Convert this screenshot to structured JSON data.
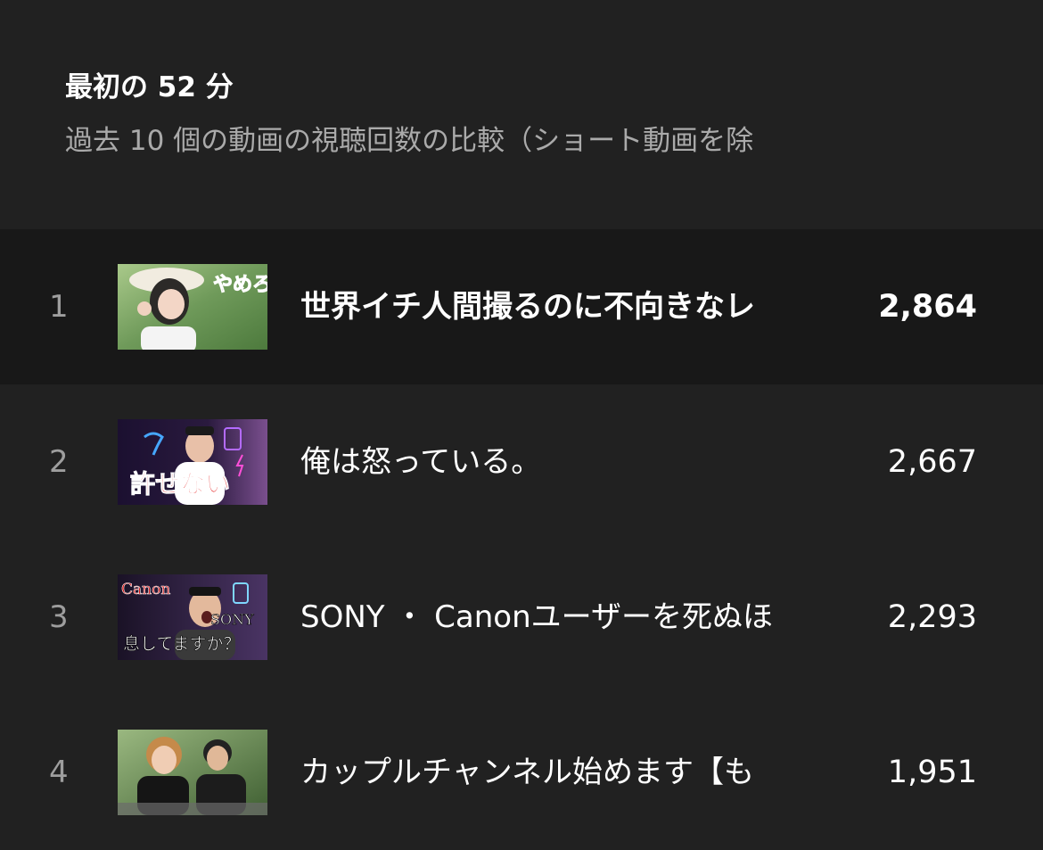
{
  "header": {
    "title": "最初の 52 分",
    "subtitle": "過去 10 個の動画の視聴回数の比較（ショート動画を除"
  },
  "videos": [
    {
      "rank": "1",
      "title": "世界イチ人間撮るのに不向きなレ",
      "views": "2,864",
      "thumbnail_text": "やめろ"
    },
    {
      "rank": "2",
      "title": "俺は怒っている。",
      "views": "2,667",
      "thumbnail_text": "許せない"
    },
    {
      "rank": "3",
      "title": "SONY ・ Canonユーザーを死ぬほ",
      "views": "2,293",
      "thumbnail_text_1": "Canon",
      "thumbnail_text_2": "SONY",
      "thumbnail_text_3": "息してますか？"
    },
    {
      "rank": "4",
      "title": "カップルチャンネル始めます【も",
      "views": "1,951"
    }
  ],
  "colors": {
    "background": "#212121",
    "highlight_row": "#181818",
    "subtitle": "#aaaaaa",
    "rank": "#9e9e9e",
    "text": "#ffffff"
  }
}
